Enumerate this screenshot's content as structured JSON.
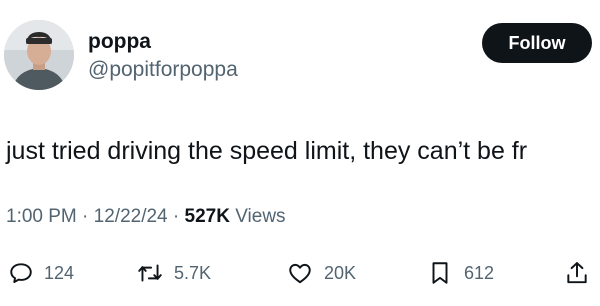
{
  "author": {
    "display_name": "poppa",
    "handle": "@popitforpoppa"
  },
  "follow_label": "Follow",
  "tweet": {
    "text": "just tried driving the speed limit, they can’t be fr",
    "time": "1:00 PM",
    "date": "12/22/24",
    "separator": " · ",
    "views_count": "527K",
    "views_label": " Views"
  },
  "actions": {
    "replies": "124",
    "reposts": "5.7K",
    "likes": "20K",
    "bookmarks": "612"
  },
  "colors": {
    "text": "#0f1419",
    "secondary": "#536471",
    "follow_bg": "#0f1419"
  },
  "icons": [
    "reply-icon",
    "repost-icon",
    "like-icon",
    "bookmark-icon",
    "share-icon"
  ]
}
